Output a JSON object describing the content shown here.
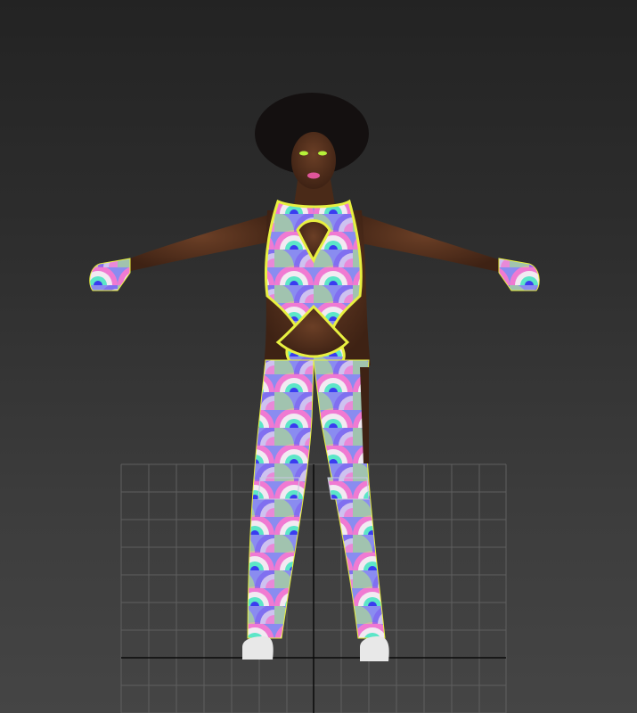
{
  "viewport": {
    "background_top": "#232323",
    "background_bottom": "#454545",
    "grid_color": "#5f5f5f",
    "axis_color": "#0a0a0a"
  },
  "model": {
    "skin": "#5a3420",
    "hair": "#141010",
    "suit_trim": "#e8f040",
    "suit_pattern_colors": [
      "#7a5cf0",
      "#f07ad2",
      "#5ce6c8",
      "#f0e6f0",
      "#3a3cf0",
      "#b4f07a"
    ],
    "boot_sole": "#e8e8e8",
    "lips": "#e0559a",
    "eyeshadow": "#b6f23a"
  }
}
